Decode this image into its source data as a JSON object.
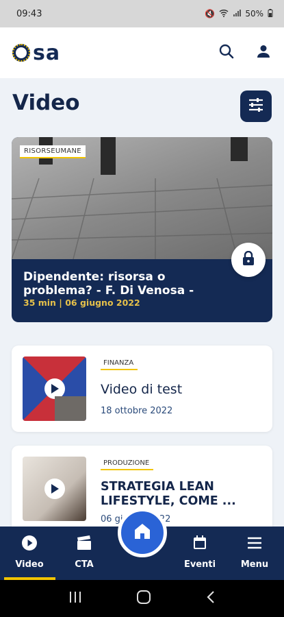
{
  "status": {
    "time": "09:43",
    "battery": "50%"
  },
  "app": {
    "logo_text": "sa"
  },
  "page": {
    "title": "Video"
  },
  "hero": {
    "tag": "RISORSEUMANE",
    "title": "Dipendente: risorsa o problema? - F. Di Venosa -",
    "meta": "35 min  |  06 giugno 2022"
  },
  "cards": [
    {
      "tag": "FINANZA",
      "title": "Video di test",
      "date": "18 ottobre 2022"
    },
    {
      "tag": "PRODUZIONE",
      "title": "STRATEGIA LEAN LIFESTYLE, COME ...",
      "date": "06 giugno 2022"
    }
  ],
  "nav": {
    "video": "Video",
    "cta": "CTA",
    "eventi": "Eventi",
    "menu": "Menu"
  },
  "colors": {
    "primary": "#142a54",
    "accent": "#f2c400",
    "fab": "#2a63d6"
  }
}
